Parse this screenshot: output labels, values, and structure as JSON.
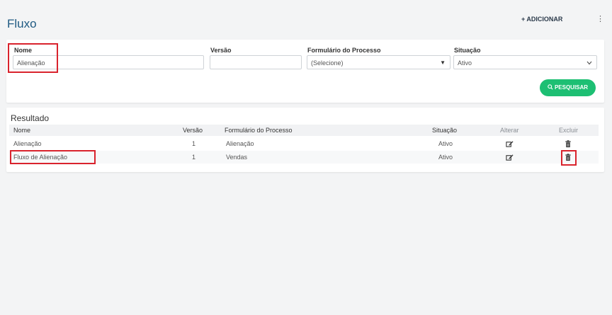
{
  "header": {
    "title": "Fluxo",
    "add_label": "+ ADICIONAR",
    "menu_label": "⋮"
  },
  "filters": {
    "nome": {
      "label": "Nome",
      "value": "Alienação"
    },
    "versao": {
      "label": "Versão",
      "value": ""
    },
    "formulario": {
      "label": "Formulário do Processo",
      "value": "(Selecione)"
    },
    "situacao": {
      "label": "Situação",
      "value": "Ativo"
    },
    "search_label": "PESQUISAR"
  },
  "results": {
    "title": "Resultado",
    "columns": [
      "Nome",
      "Versão",
      "Formulário do Processo",
      "Situação",
      "Alterar",
      "Excluir"
    ],
    "rows": [
      {
        "nome": "Alienação",
        "versao": "1",
        "formulario": "Alienação",
        "situacao": "Ativo"
      },
      {
        "nome": "Fluxo de Alienação",
        "versao": "1",
        "formulario": "Vendas",
        "situacao": "Ativo"
      }
    ]
  },
  "colors": {
    "accent_green": "#1dbf73",
    "title_blue": "#1f5a82",
    "highlight_red": "#d9232d"
  },
  "icons": {
    "edit": "edit-icon",
    "delete": "trash-icon",
    "search": "search-icon",
    "dropdown": "chevron-down-icon"
  }
}
